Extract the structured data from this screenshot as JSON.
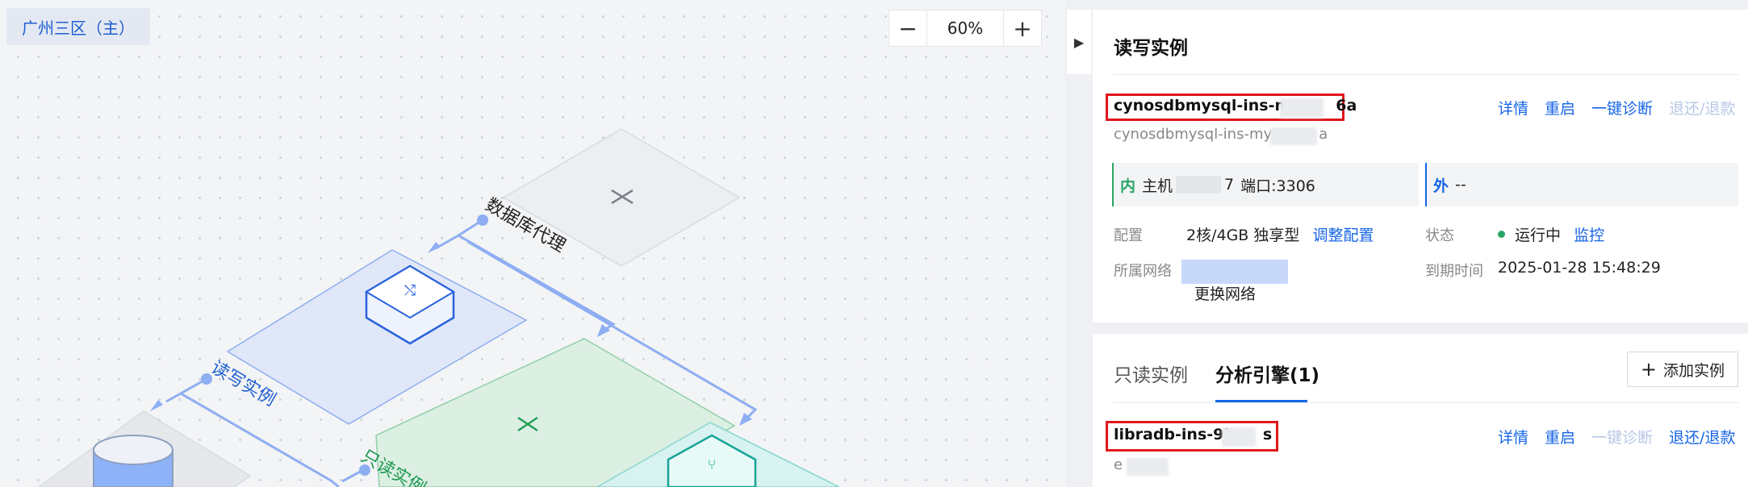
{
  "canvas": {
    "region": "广州三区（主）",
    "zoom": {
      "minus": "−",
      "value": "60%",
      "plus": "+"
    },
    "nodes": {
      "proxy": "数据库代理",
      "rw": "读写实例",
      "ro": "只读实例"
    }
  },
  "panel": {
    "collapse_icon": "▶",
    "rw_section": {
      "title": "读写实例",
      "instance_id": "cynosdbmysql-ins-m",
      "instance_id_suffix": "6a",
      "instance_name": "cynosdbmysql-ins-my",
      "instance_name_suffix": "a",
      "actions": {
        "detail": "详情",
        "restart": "重启",
        "diagnose": "一键诊断",
        "return": "退还/退款"
      },
      "intranet": {
        "tag": "内",
        "host_label": "主机",
        "host_suffix": "7",
        "port_text": "端口:3306"
      },
      "extranet": {
        "tag": "外",
        "value": "--"
      },
      "config_label": "配置",
      "config_value": "2核/4GB 独享型",
      "config_link": "调整配置",
      "status_label": "状态",
      "status_value": "运行中",
      "monitor_link": "监控",
      "network_label": "所属网络",
      "network_link": "更换网络",
      "expire_label": "到期时间",
      "expire_value": "2025-01-28 15:48:29"
    },
    "tabs": {
      "readonly": "只读实例",
      "analytics": "分析引擎(1)",
      "add_button": "添加实例",
      "add_icon": "+"
    },
    "analytics_instance": {
      "instance_id": "libradb-ins-9j",
      "instance_id_suffix": "s",
      "sub_prefix": "e",
      "actions": {
        "detail": "详情",
        "restart": "重启",
        "diagnose": "一键诊断",
        "return": "退还/退款"
      }
    }
  },
  "colors": {
    "accent": "#1665e6",
    "running": "#2aa566",
    "highlight_box": "#e0161c"
  }
}
